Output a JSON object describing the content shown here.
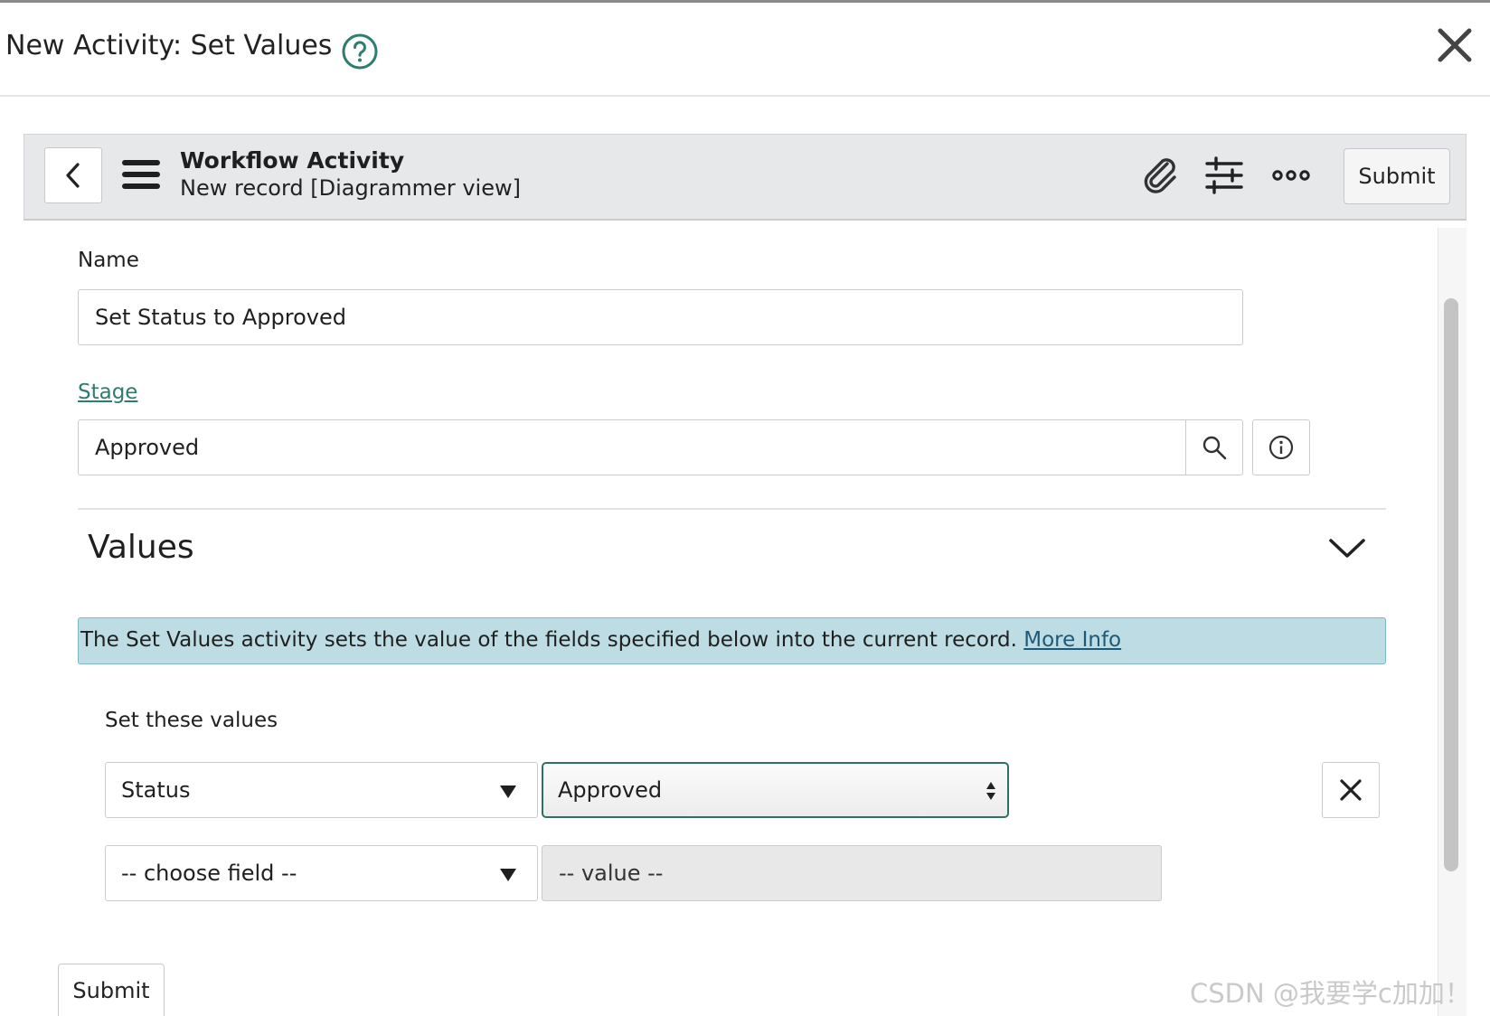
{
  "modal": {
    "title": "New Activity: Set Values"
  },
  "form_header": {
    "table_name": "Workflow Activity",
    "record_label": "New record [Diagrammer view]",
    "submit_label": "Submit"
  },
  "fields": {
    "name_label": "Name",
    "name_value": "Set Status to Approved",
    "stage_label": "Stage",
    "stage_value": "Approved"
  },
  "values_section": {
    "title": "Values",
    "info_text": "The Set Values activity sets the value of the fields specified below into the current record.",
    "more_info_link": "More Info",
    "set_label": "Set these values",
    "rows": [
      {
        "field": "Status",
        "value": "Approved"
      },
      {
        "field": "-- choose field --",
        "value": "-- value --"
      }
    ]
  },
  "footer": {
    "submit_label": "Submit"
  },
  "watermark": "CSDN @我要学c加加！",
  "colors": {
    "accent": "#2e7d6e",
    "header_bar": "#e7e8ea",
    "info_banner": "#bddce3"
  }
}
